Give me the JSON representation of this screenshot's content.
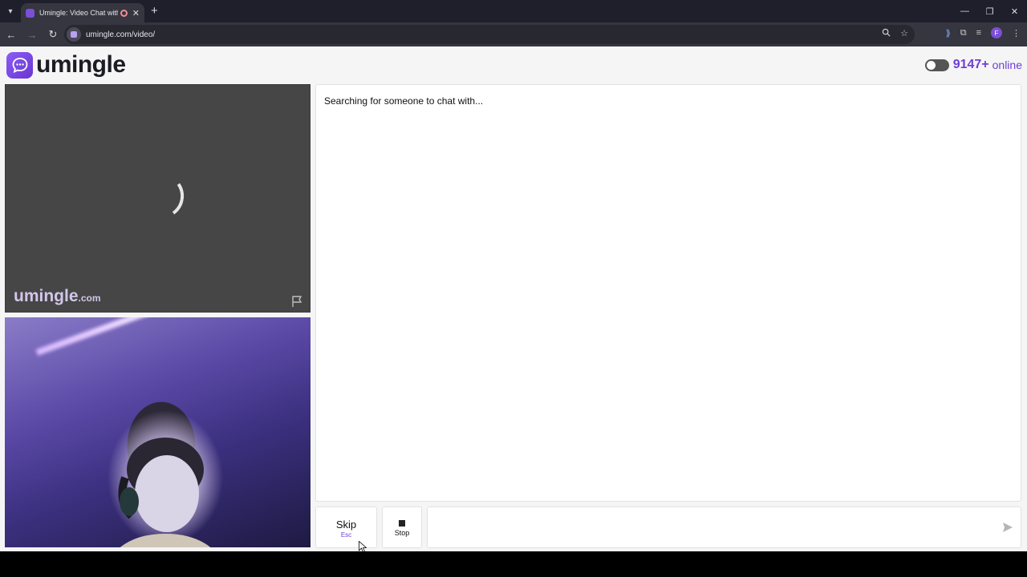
{
  "browser": {
    "tab_title": "Umingle: Video Chat with S",
    "url": "umingle.com/video/",
    "window_controls": {
      "minimize": "—",
      "restore": "❐",
      "close": "✕"
    },
    "profile_initial": "F"
  },
  "header": {
    "logo_text": "umingle",
    "online_count": "9147+",
    "online_label": "online"
  },
  "stranger_video": {
    "watermark_name": "umingle",
    "watermark_domain": ".com"
  },
  "chat": {
    "status_text": "Searching for someone to chat with..."
  },
  "controls": {
    "skip_label": "Skip",
    "skip_hint": "Esc",
    "stop_label": "Stop",
    "message_placeholder": ""
  },
  "colors": {
    "brand": "#6d3fd6",
    "page_bg": "#f5f5f6",
    "video_bg": "#464646"
  }
}
